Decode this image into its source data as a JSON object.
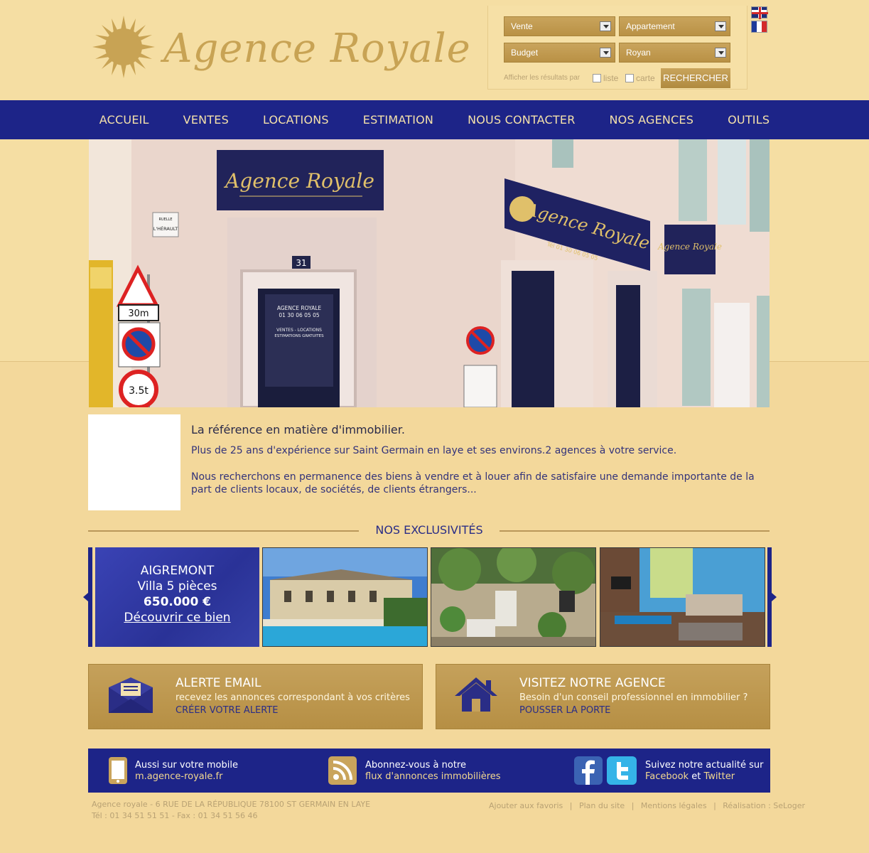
{
  "logo": {
    "text": "Agence Royale"
  },
  "search": {
    "transaction": "Vente",
    "property_type": "Appartement",
    "budget": "Budget",
    "city": "Royan",
    "results_label": "Afficher les résultats par",
    "option_list": "liste",
    "option_map": "carte",
    "submit": "RECHERCHER"
  },
  "nav": [
    "ACCUEIL",
    "VENTES",
    "LOCATIONS",
    "ESTIMATION",
    "NOUS CONTACTER",
    "NOS AGENCES",
    "OUTILS"
  ],
  "hero": {
    "sign_main": "Agence Royale",
    "sign_side": "Agence Royale",
    "sign_small": "Agence Royale",
    "phone": "Tél 01 30 06 05 05",
    "door_name": "AGENCE ROYALE",
    "door_phone": "01 30 06 05 05",
    "door_services": "VENTES - LOCATIONS",
    "door_services2": "ESTIMATIONS GRATUITES",
    "house_number": "31",
    "street_sign": "L'HÉRAULT",
    "street_prefix": "RUELLE",
    "height_sign": "30m",
    "weight_sign": "3.5t"
  },
  "intro": {
    "title": "La référence en matière d'immobilier.",
    "p1": "Plus de 25 ans d'expérience sur Saint Germain en laye et ses environs.2 agences à votre service.",
    "p2": "Nous recherchons en permanence des biens à vendre et à louer afin de satisfaire une demande importante de la part de clients locaux, de sociétés, de clients étrangers..."
  },
  "exclusives": {
    "title": "NOS EXCLUSIVITÉS",
    "featured": {
      "city": "AIGREMONT",
      "type": "Villa 5 pièces",
      "price": "650.000 €",
      "link": "Découvrir ce bien"
    }
  },
  "promos": {
    "alert": {
      "title": "ALERTE EMAIL",
      "subtitle": "recevez les annonces correspondant à vos critères",
      "cta": "CRÉER VOTRE ALERTE"
    },
    "visit": {
      "title": "VISITEZ NOTRE AGENCE",
      "subtitle": "Besoin d'un conseil professionnel en immobilier ?",
      "cta": "POUSSER LA PORTE"
    }
  },
  "band": {
    "mobile_title": "Aussi sur votre  mobile",
    "mobile_url": "m.agence-royale.fr",
    "rss_title": "Abonnez-vous à notre",
    "rss_sub": "flux d'annonces immobilières",
    "social_title": "Suivez notre actualité sur",
    "social_facebook": "Facebook",
    "social_and": "et",
    "social_twitter": "Twitter"
  },
  "footer": {
    "address": "Agence royale - 6 RUE DE LA RÉPUBLIQUE 78100 ST GERMAIN EN LAYE",
    "phones": "Tél : 01 34 51 51 51 - Fax : 01 34 51 56 46",
    "links": [
      "Ajouter aux favoris",
      "Plan du site",
      "Mentions légales",
      "Réalisation : SeLoger"
    ],
    "separator": "|"
  },
  "colors": {
    "background": "#f5dea3",
    "navy": "#1d2488",
    "gold": "#c8a354"
  }
}
